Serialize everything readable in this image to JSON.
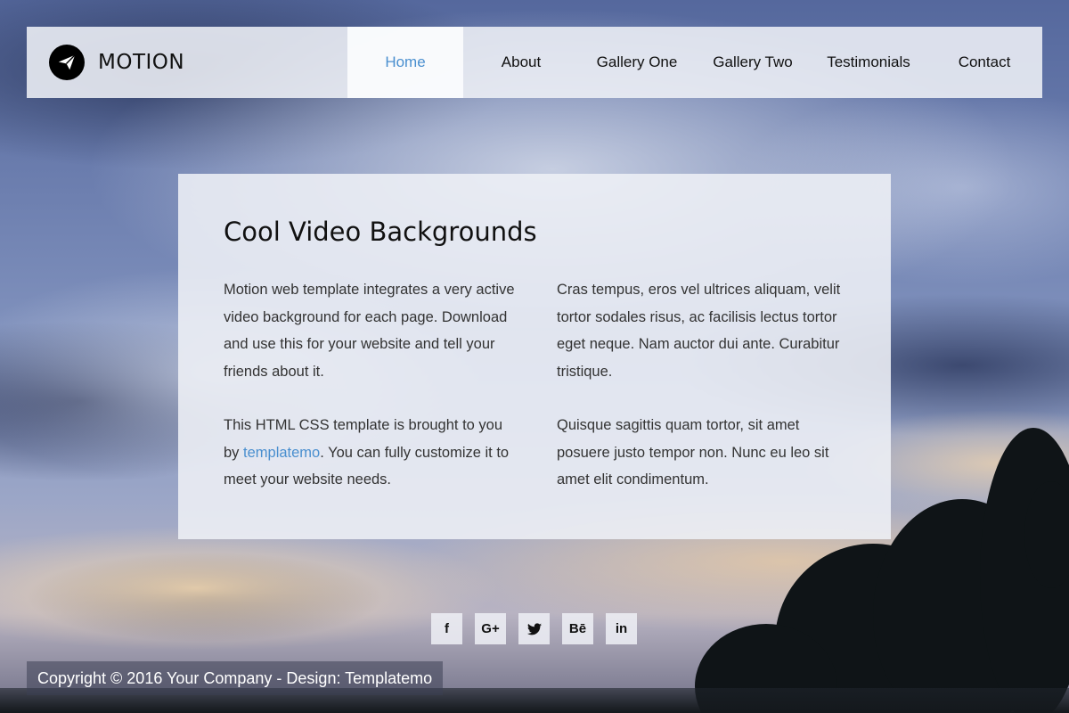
{
  "colors": {
    "accent": "#4a8fcf",
    "panel_bg": "#eef0f6",
    "text": "#333333",
    "heading": "#111111"
  },
  "brand": {
    "name": "MOTION",
    "logo_icon": "paper-plane-icon"
  },
  "nav": {
    "items": [
      {
        "label": "Home",
        "active": true
      },
      {
        "label": "About",
        "active": false
      },
      {
        "label": "Gallery One",
        "active": false
      },
      {
        "label": "Gallery Two",
        "active": false
      },
      {
        "label": "Testimonials",
        "active": false
      },
      {
        "label": "Contact",
        "active": false
      }
    ]
  },
  "main": {
    "title": "Cool Video Backgrounds",
    "left": {
      "p1": "Motion web template integrates a very active video background for each page. Download and use this for your website and tell your friends about it.",
      "p2_before": "This HTML CSS template is brought to you by ",
      "p2_link": "templatemo",
      "p2_after": ". You can fully customize it to meet your website needs."
    },
    "right": {
      "p1": "Cras tempus, eros vel ultrices aliquam, velit tortor sodales risus, ac facilisis lectus tortor eget neque. Nam auctor dui ante. Curabitur tristique.",
      "p2": "Quisque sagittis quam tortor, sit amet posuere justo tempor non. Nunc eu leo sit amet elit condimentum."
    }
  },
  "social": [
    {
      "icon": "facebook-icon",
      "glyph": "f"
    },
    {
      "icon": "google-plus-icon",
      "glyph": "G+"
    },
    {
      "icon": "twitter-icon",
      "glyph": "🐦"
    },
    {
      "icon": "behance-icon",
      "glyph": "Bē"
    },
    {
      "icon": "linkedin-icon",
      "glyph": "in"
    }
  ],
  "footer": {
    "copyright": "Copyright © 2016 Your Company - Design: Templatemo"
  }
}
